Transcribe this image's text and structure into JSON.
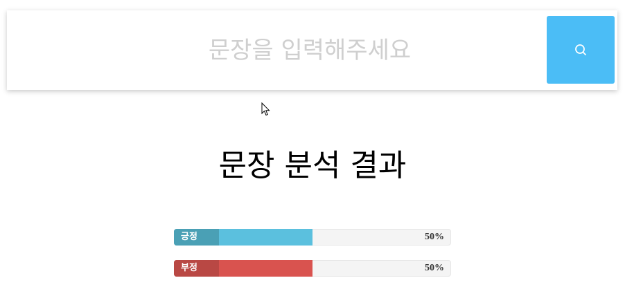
{
  "search": {
    "placeholder": "문장을 입력해주세요",
    "value": "",
    "button_icon": "search-icon",
    "button_color": "#4bbdf6"
  },
  "result": {
    "title": "문장 분석 결과",
    "bars": [
      {
        "label": "긍정",
        "percent_text": "50%",
        "percent": 50,
        "fill_color": "#5bc0de",
        "label_color": "#4aa0b5"
      },
      {
        "label": "부정",
        "percent_text": "50%",
        "percent": 50,
        "fill_color": "#d9534f",
        "label_color": "#b94844"
      }
    ]
  }
}
